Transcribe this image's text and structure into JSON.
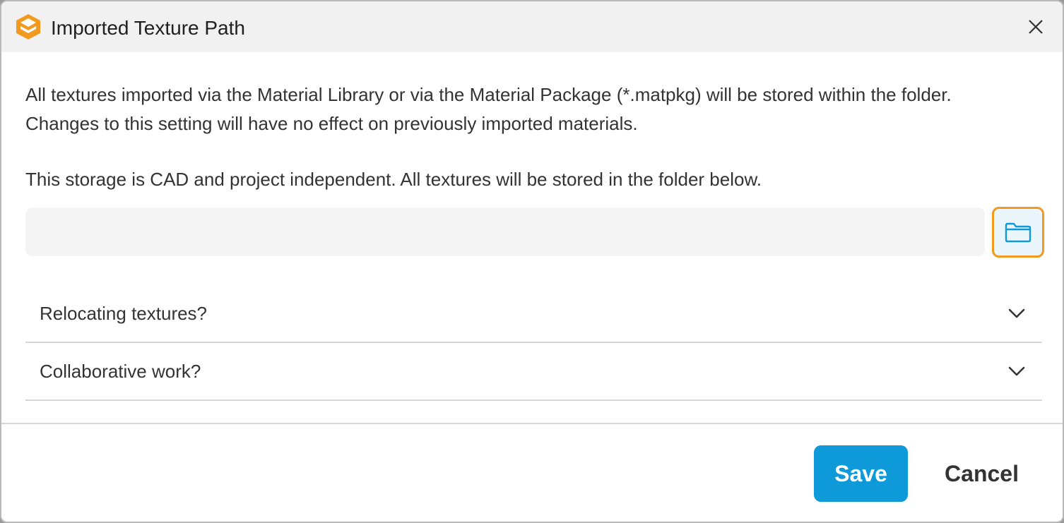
{
  "window": {
    "title": "Imported Texture Path",
    "app_icon": "app-logo-icon",
    "close_icon": "close-icon"
  },
  "content": {
    "description": "All textures imported via the Material Library or via the Material Package (*.matpkg) will be stored within the folder. Changes to this setting will have no effect on previously imported materials.",
    "storage_note": "This storage is CAD and project independent. All textures will be stored in the folder below.",
    "path_input": {
      "value": "",
      "placeholder": ""
    },
    "browse_icon": "folder-icon"
  },
  "accordions": [
    {
      "label": "Relocating textures?",
      "icon": "chevron-down-icon"
    },
    {
      "label": "Collaborative work?",
      "icon": "chevron-down-icon"
    }
  ],
  "footer": {
    "save_label": "Save",
    "cancel_label": "Cancel"
  },
  "colors": {
    "accent_orange": "#f29a1f",
    "primary_blue": "#0e9ad9",
    "titlebar_bg": "#f1f1f1"
  }
}
